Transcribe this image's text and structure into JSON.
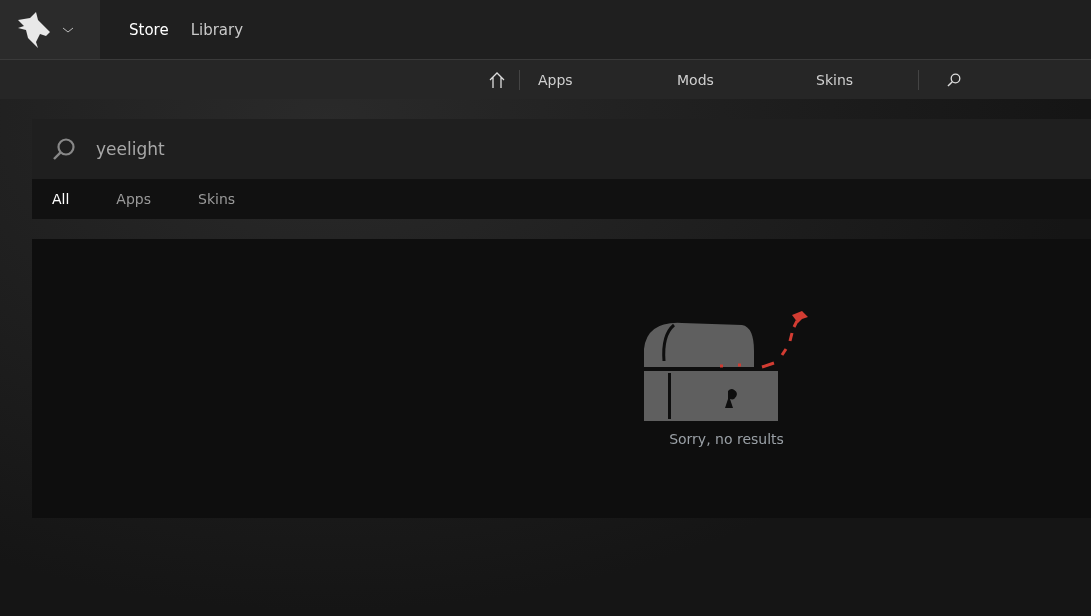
{
  "top_tabs": [
    {
      "label": "Store",
      "selected": true
    },
    {
      "label": "Library",
      "selected": false
    }
  ],
  "nav": {
    "items": [
      {
        "label": "Apps"
      },
      {
        "label": "Mods"
      },
      {
        "label": "Skins"
      }
    ]
  },
  "search": {
    "value": "yeelight"
  },
  "filters": [
    {
      "label": "All",
      "selected": true
    },
    {
      "label": "Apps",
      "selected": false
    },
    {
      "label": "Skins",
      "selected": false
    }
  ],
  "empty_message": "Sorry, no results"
}
